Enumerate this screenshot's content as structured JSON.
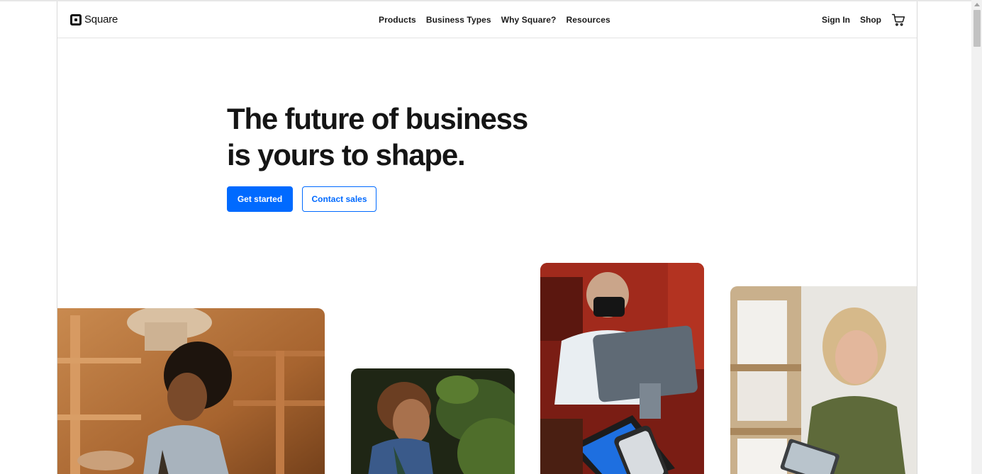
{
  "brand": {
    "name": "Square",
    "icon": "square-logo-icon"
  },
  "nav": {
    "items": [
      {
        "label": "Products"
      },
      {
        "label": "Business Types"
      },
      {
        "label": "Why Square?"
      },
      {
        "label": "Resources"
      }
    ],
    "sign_in": "Sign In",
    "shop": "Shop",
    "cart_icon": "shopping-cart-icon"
  },
  "hero": {
    "headline_line1": "The future of business",
    "headline_line2": "is yours to shape.",
    "primary_cta": "Get started",
    "secondary_cta": "Contact sales"
  },
  "photos": [
    {
      "name": "pottery-shop-photo"
    },
    {
      "name": "plant-nursery-photo"
    },
    {
      "name": "restaurant-checkout-photo"
    },
    {
      "name": "warehouse-tablet-photo"
    }
  ],
  "colors": {
    "accent": "#006aff",
    "text": "#151515",
    "border": "#e3e3e3"
  }
}
